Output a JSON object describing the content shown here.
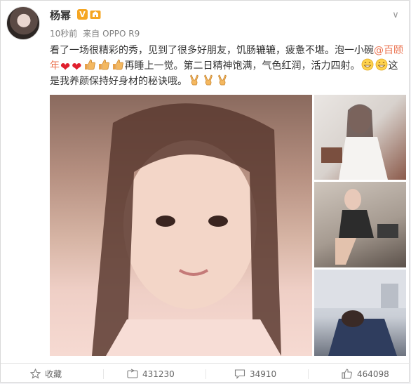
{
  "post": {
    "username": "杨幂",
    "verified_badge": "V",
    "meta": {
      "time": "10秒前",
      "source_prefix": "来自",
      "source": "OPPO R9"
    },
    "content": {
      "line1": "看了一场很精彩的秀，见到了很多好朋友，饥肠辘辘，疲惫不堪。泡一小碗",
      "mention": "@百颐年",
      "line2": "再睡上一觉。第二日精神饱满，气色红润，活力四射。",
      "line3": "这是我养颜保持好身材的秘诀哦。",
      "emoji": {
        "hearts": [
          "❤",
          "❤"
        ],
        "thumbs": [
          "thumbs-up-icon",
          "thumbs-up-icon",
          "thumbs-up-icon"
        ],
        "grin": "grin-icon",
        "victory": [
          "victory-hand-icon",
          "victory-hand-icon",
          "victory-hand-icon"
        ]
      }
    }
  },
  "actions": {
    "favorite_label": "收藏",
    "repost_count": "431230",
    "comment_count": "34910",
    "like_count": "464098"
  },
  "colors": {
    "mention": "#eb7350",
    "verified": "#f5a623",
    "heart": "#e0202e"
  }
}
